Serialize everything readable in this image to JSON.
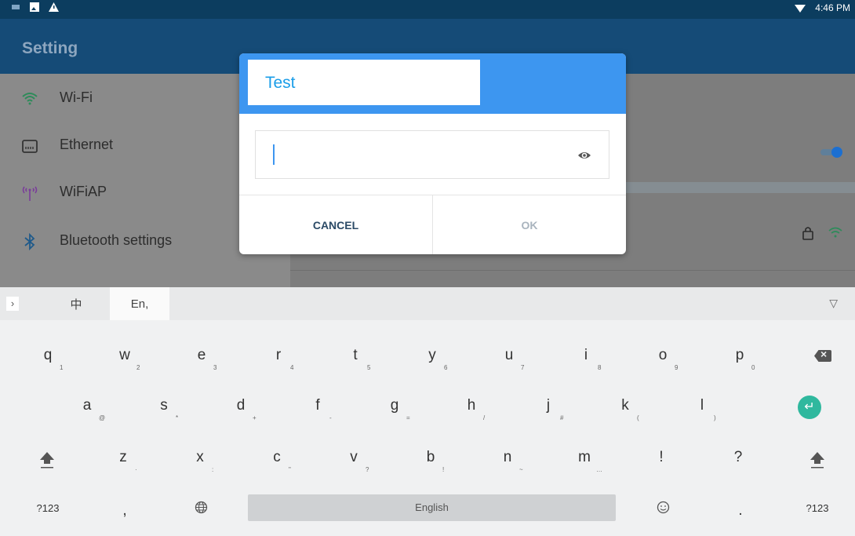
{
  "status_bar": {
    "time": "4:46 PM"
  },
  "app_bar": {
    "title": "Setting"
  },
  "nav_items": [
    {
      "label": "Wi-Fi",
      "icon": "wifi-icon"
    },
    {
      "label": "Ethernet",
      "icon": "ethernet-icon"
    },
    {
      "label": "WiFiAP",
      "icon": "hotspot-icon"
    },
    {
      "label": "Bluetooth settings",
      "icon": "bluetooth-icon"
    }
  ],
  "dialog": {
    "title": "Test",
    "password_value": "",
    "cancel_label": "CANCEL",
    "ok_label": "OK"
  },
  "keyboard": {
    "lang_zh": "中",
    "lang_en": "En,",
    "row1": [
      {
        "k": "q",
        "s": "1"
      },
      {
        "k": "w",
        "s": "2"
      },
      {
        "k": "e",
        "s": "3"
      },
      {
        "k": "r",
        "s": "4"
      },
      {
        "k": "t",
        "s": "5"
      },
      {
        "k": "y",
        "s": "6"
      },
      {
        "k": "u",
        "s": "7"
      },
      {
        "k": "i",
        "s": "8"
      },
      {
        "k": "o",
        "s": "9"
      },
      {
        "k": "p",
        "s": "0"
      }
    ],
    "row2": [
      {
        "k": "a",
        "s": "@"
      },
      {
        "k": "s",
        "s": "*"
      },
      {
        "k": "d",
        "s": "+"
      },
      {
        "k": "f",
        "s": "-"
      },
      {
        "k": "g",
        "s": "="
      },
      {
        "k": "h",
        "s": "/"
      },
      {
        "k": "j",
        "s": "#"
      },
      {
        "k": "k",
        "s": "("
      },
      {
        "k": "l",
        "s": ")"
      }
    ],
    "row3": [
      {
        "k": "z",
        "s": "·"
      },
      {
        "k": "x",
        "s": ":"
      },
      {
        "k": "c",
        "s": "\""
      },
      {
        "k": "v",
        "s": "?"
      },
      {
        "k": "b",
        "s": "!"
      },
      {
        "k": "n",
        "s": "~"
      },
      {
        "k": "m",
        "s": "…"
      },
      {
        "k": "!",
        "s": ""
      },
      {
        "k": "?",
        "s": ""
      }
    ],
    "symbols_label": "?123",
    "comma": ",",
    "period": ".",
    "space_label": "English"
  },
  "colors": {
    "dialog_header": "#3d96f0",
    "enter_key": "#2fb89e",
    "app_bar": "#154b77"
  }
}
